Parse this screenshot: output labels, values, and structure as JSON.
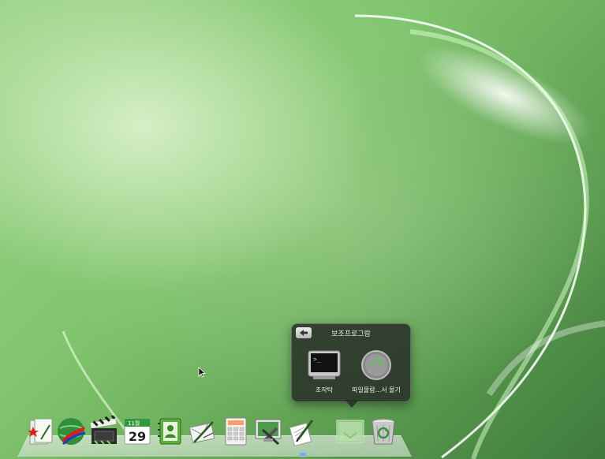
{
  "stack": {
    "title": "보조프로그람",
    "items": [
      {
        "label": "조작탁",
        "icon": "terminal-icon"
      },
      {
        "label": "파일몰람...서 몰기",
        "icon": "file-sharing-icon"
      }
    ]
  },
  "dock": {
    "items": [
      {
        "name": "star-app-icon"
      },
      {
        "name": "globe-browser-icon"
      },
      {
        "name": "clapperboard-video-icon"
      },
      {
        "name": "calendar-icon"
      },
      {
        "name": "address-book-icon"
      },
      {
        "name": "letter-mail-icon"
      },
      {
        "name": "calculator-icon"
      },
      {
        "name": "system-tools-icon"
      },
      {
        "name": "document-pen-icon"
      },
      {
        "name": "stack-folder-icon"
      },
      {
        "name": "trash-icon"
      }
    ],
    "calendar": {
      "month": "11월",
      "day": "29"
    }
  },
  "colors": {
    "wallpaper_light": "#9dd48a",
    "wallpaper_dark": "#3f7a3d",
    "popup_bg": "#283028"
  }
}
